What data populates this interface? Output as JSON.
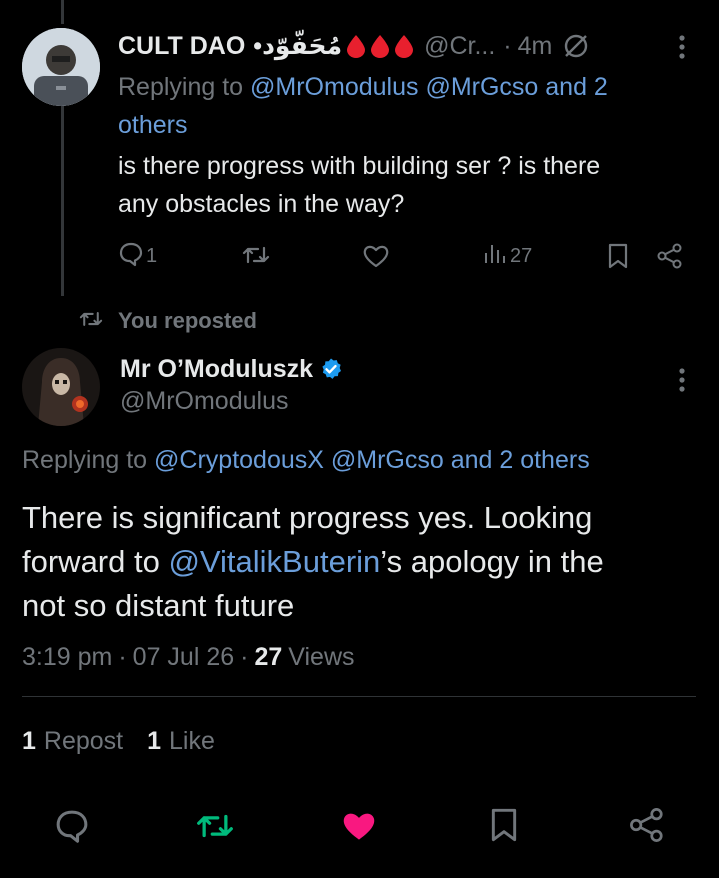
{
  "reply_tweet": {
    "author_name": "CULT DAO",
    "author_suffix": "•مُحَفّوّد",
    "handle": "@Cr...",
    "separator": "·",
    "time": "4m",
    "replying_prefix": "Replying to",
    "replying_handles": "@MrOmodulus @MrGcso and 2",
    "replying_others": "others",
    "text_line1": "is there progress with building ser ? is there",
    "text_line2": "any obstacles in the way?",
    "reply_count": "1",
    "views_count": "27",
    "drop_color": "#e8202e"
  },
  "repost_banner": {
    "label": "You reposted"
  },
  "main_tweet": {
    "author_name": "Mr O’Moduluszk",
    "handle": "@MrOmodulus",
    "replying_prefix": "Replying to",
    "replying_handles": "@CryptodousX @MrGcso and 2 others",
    "text_line1": "There is significant progress yes. Looking",
    "text_line2_prefix": "forward to ",
    "text_line2_mention": "@VitalikButerin",
    "text_line2_suffix": "’s apology in the",
    "text_line3": "not so distant future",
    "time": "3:19 pm",
    "sep1": "·",
    "date": "07 Jul 26",
    "sep2": "·",
    "views_count": "27",
    "views_label": "Views",
    "repost_count": "1",
    "repost_label": "Repost",
    "like_count": "1",
    "like_label": "Like"
  },
  "colors": {
    "accent_blue": "#1d9bf0",
    "link_blue": "#6b9eda",
    "repost_green": "#00ba7c",
    "like_pink": "#f91880",
    "muted": "#71767b"
  }
}
